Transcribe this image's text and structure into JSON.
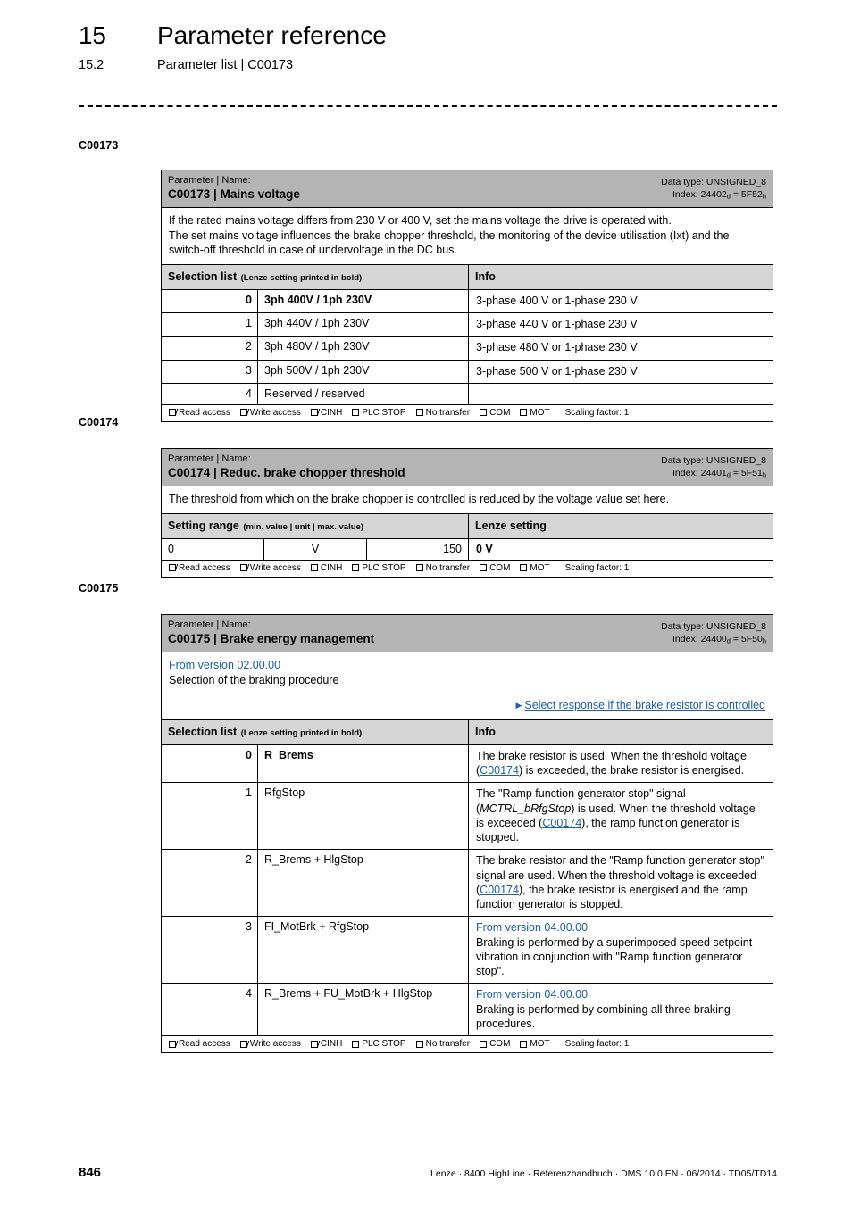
{
  "header": {
    "chapter_number": "15",
    "chapter_title": "Parameter reference",
    "section_number": "15.2",
    "section_title": "Parameter list | C00173"
  },
  "margin_labels": {
    "first": "C00173",
    "second": "C00174",
    "third": "C00175"
  },
  "common": {
    "param_name_caption": "Parameter | Name:",
    "data_type_label": "Data type: UNSIGNED_8",
    "index_prefix": "Index: ",
    "selection_list_title": "Selection list",
    "selection_list_note": "(Lenze setting printed in bold)",
    "info_title": "Info",
    "access": {
      "read": "Read access",
      "write": "Write access",
      "cinh": "CINH",
      "plc_stop": "PLC STOP",
      "no_transfer": "No transfer",
      "com": "COM",
      "mot": "MOT",
      "scaling": "Scaling factor: 1"
    }
  },
  "c00173": {
    "title": "C00173 | Mains voltage",
    "data_type": "Data type: UNSIGNED_8",
    "index_dec": "24402",
    "index_hex": "5F52",
    "description_lines": [
      "If the rated mains voltage differs from 230 V or 400 V, set the mains voltage the drive is operated with.",
      "The set mains voltage influences the brake chopper threshold, the monitoring of the device utilisation (Ixt) and the switch-off threshold in case of undervoltage in the DC bus."
    ],
    "rows": [
      {
        "index": "0",
        "name": "3ph 400V / 1ph 230V",
        "info": "3-phase 400 V or 1-phase 230 V",
        "bold": true
      },
      {
        "index": "1",
        "name": "3ph 440V / 1ph 230V",
        "info": "3-phase 440 V or 1-phase 230 V",
        "bold": false
      },
      {
        "index": "2",
        "name": "3ph 480V / 1ph 230V",
        "info": "3-phase 480 V or 1-phase 230 V",
        "bold": false
      },
      {
        "index": "3",
        "name": "3ph 500V / 1ph 230V",
        "info": "3-phase 500 V or 1-phase 230 V",
        "bold": false
      },
      {
        "index": "4",
        "name": "Reserved / reserved",
        "info": "",
        "bold": false
      }
    ],
    "access_checked": {
      "read": true,
      "write": true,
      "cinh": true,
      "plc_stop": false,
      "no_transfer": false,
      "com": false,
      "mot": false
    }
  },
  "c00174": {
    "title": "C00174 | Reduc. brake chopper threshold",
    "data_type": "Data type: UNSIGNED_8",
    "index_dec": "24401",
    "index_hex": "5F51",
    "description_lines": [
      "The threshold from which on the brake chopper is controlled is reduced by the voltage value set here."
    ],
    "setting_range_title": "Setting range",
    "setting_range_note": "(min. value | unit | max. value)",
    "lenze_setting_title": "Lenze setting",
    "min_value": "0",
    "unit": "V",
    "max_value": "150",
    "lenze_setting_value": "0 V",
    "access_checked": {
      "read": true,
      "write": true,
      "cinh": false,
      "plc_stop": false,
      "no_transfer": false,
      "com": false,
      "mot": false
    }
  },
  "c00175": {
    "title": "C00175 | Brake energy management",
    "data_type": "Data type: UNSIGNED_8",
    "index_dec": "24400",
    "index_hex": "5F50",
    "from_version": "From version 02.00.00",
    "description": "Selection of the braking procedure",
    "cross_reference_link": "Select response if the brake resistor is controlled",
    "rows": [
      {
        "index": "0",
        "name": "R_Brems",
        "bold": true,
        "info_pre": "The brake resistor is used. When the threshold voltage (",
        "info_link": "C00174",
        "info_post": ") is exceeded, the brake resistor is energised."
      },
      {
        "index": "1",
        "name": "RfgStop",
        "bold": false,
        "info_pre": "The \"Ramp function generator stop\" signal (",
        "info_italic": "MCTRL_bRfgStop",
        "info_mid": ") is used. When the threshold voltage is exceeded (",
        "info_link": "C00174",
        "info_post": "), the ramp function generator is stopped."
      },
      {
        "index": "2",
        "name": "R_Brems + HlgStop",
        "bold": false,
        "info_pre": "The brake resistor and the \"Ramp function generator stop\" signal are used. When the threshold voltage is exceeded (",
        "info_link": "C00174",
        "info_post": "), the brake resistor is energised and the ramp function generator is stopped."
      },
      {
        "index": "3",
        "name": "FI_MotBrk + RfgStop",
        "bold": false,
        "info_version": "From version 04.00.00",
        "info_text": "Braking is performed by a superimposed speed setpoint vibration in conjunction with \"Ramp function generator stop\"."
      },
      {
        "index": "4",
        "name": "R_Brems + FU_MotBrk + HlgStop",
        "bold": false,
        "info_version": "From version 04.00.00",
        "info_text": "Braking is performed by combining all three braking procedures."
      }
    ],
    "access_checked": {
      "read": true,
      "write": true,
      "cinh": true,
      "plc_stop": false,
      "no_transfer": false,
      "com": false,
      "mot": false
    }
  },
  "footer": {
    "page_number": "846",
    "imprint": "Lenze · 8400 HighLine · Referenzhandbuch · DMS 10.0 EN · 06/2014 · TD05/TD14"
  },
  "colors": {
    "link_blue": "#1a5fa8",
    "header_band": "#b4b4b4",
    "column_band": "#d5d5d5"
  }
}
